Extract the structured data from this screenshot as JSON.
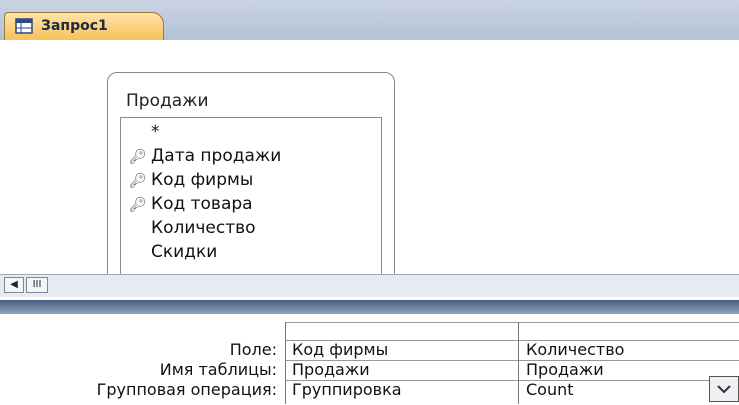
{
  "tab": {
    "title": "Запрос1",
    "icon": "query-icon"
  },
  "table": {
    "title": "Продажи",
    "fields": [
      {
        "label": "*",
        "key": false
      },
      {
        "label": "Дата продажи",
        "key": true
      },
      {
        "label": "Код фирмы",
        "key": true
      },
      {
        "label": "Код товара",
        "key": true
      },
      {
        "label": "Количество",
        "key": false
      },
      {
        "label": "Скидки",
        "key": false
      }
    ]
  },
  "scrollbar": {
    "left_arrow": "◀",
    "thumb": "III"
  },
  "grid": {
    "row_labels": {
      "field": "Поле:",
      "table_name": "Имя таблицы:",
      "group_op": "Групповая операция:"
    },
    "columns": [
      {
        "field": "Код фирмы",
        "table_name": "Продажи",
        "group_op": "Группировка"
      },
      {
        "field": "Количество",
        "table_name": "Продажи",
        "group_op": "Count"
      }
    ]
  },
  "colors": {
    "tab": "#f6c25a",
    "divider": "#4b5e7d"
  }
}
